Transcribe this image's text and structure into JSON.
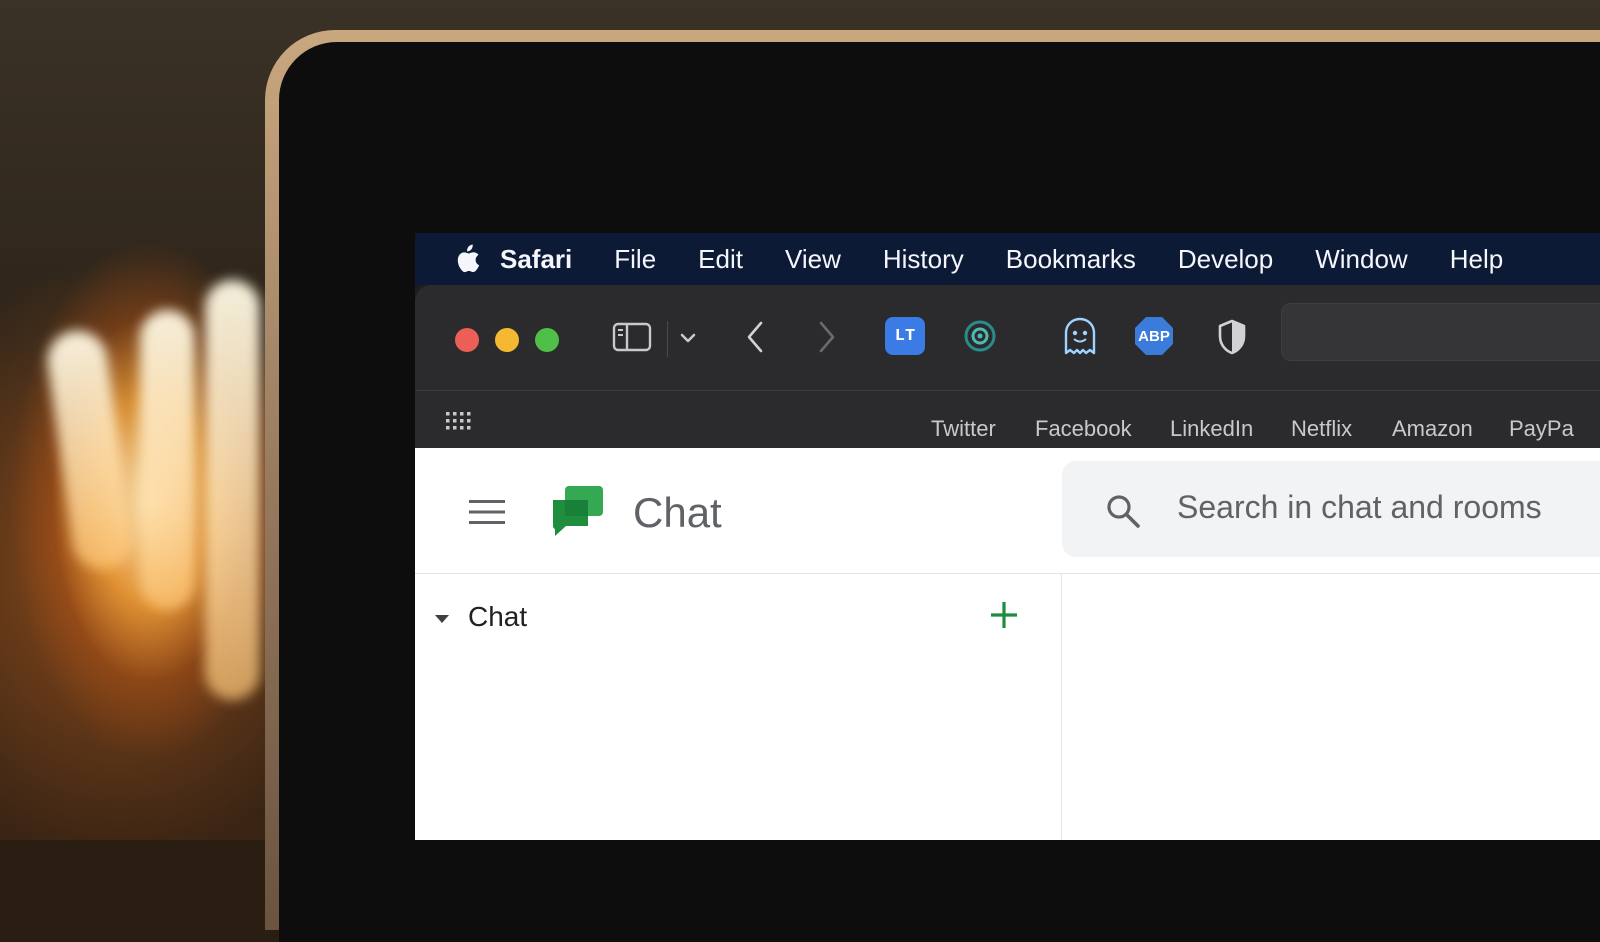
{
  "menubar": {
    "items": [
      {
        "label": "Safari",
        "bold": true
      },
      {
        "label": "File"
      },
      {
        "label": "Edit"
      },
      {
        "label": "View"
      },
      {
        "label": "History"
      },
      {
        "label": "Bookmarks"
      },
      {
        "label": "Develop"
      },
      {
        "label": "Window"
      },
      {
        "label": "Help"
      }
    ]
  },
  "toolbar": {
    "window_controls": {
      "close_color": "#ec5f57",
      "minimize_color": "#f5b833",
      "maximize_color": "#4fbf48"
    },
    "extensions": {
      "languagetool_label": "LT",
      "adblock_label": "ABP"
    }
  },
  "favorites": {
    "items": [
      "Twitter",
      "Facebook",
      "LinkedIn",
      "Netflix",
      "Amazon",
      "PayPa"
    ]
  },
  "chat_app": {
    "title": "Chat",
    "search_placeholder": "Search in chat and rooms",
    "section_label": "Chat",
    "accent_color": "#1e8e3e"
  }
}
